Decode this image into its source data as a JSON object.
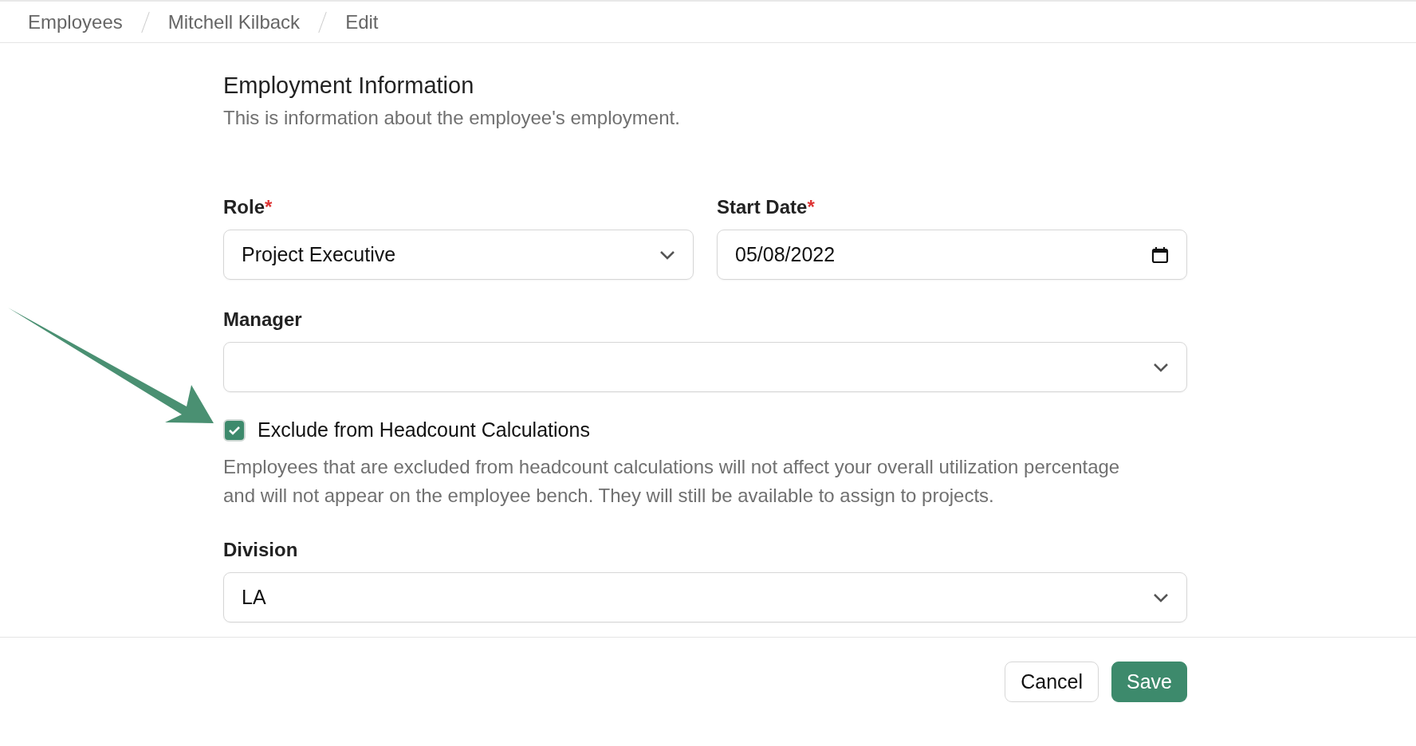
{
  "breadcrumbs": [
    {
      "label": "Employees"
    },
    {
      "label": "Mitchell Kilback"
    },
    {
      "label": "Edit"
    }
  ],
  "section": {
    "title": "Employment Information",
    "description": "This is information about the employee's employment."
  },
  "fields": [
    {
      "kind": "select",
      "label": "Role",
      "required_mark": "*",
      "value": "Project Executive"
    },
    {
      "kind": "date",
      "label": "Start Date",
      "required_mark": "*",
      "value": "05/08/2022"
    },
    {
      "kind": "select",
      "label": "Manager"
    }
  ],
  "checkbox": {
    "label": "Exclude from Headcount Calculations",
    "checked": true,
    "help": "Employees that are excluded from headcount calculations will not affect your overall utilization percentage and will not appear on the employee bench. They will still be available to assign to projects."
  },
  "division": {
    "kind": "select",
    "label": "Division",
    "value": "LA"
  },
  "buttons": [
    {
      "kind": "secondary",
      "label": "Cancel"
    },
    {
      "kind": "primary",
      "label": "Save"
    }
  ]
}
